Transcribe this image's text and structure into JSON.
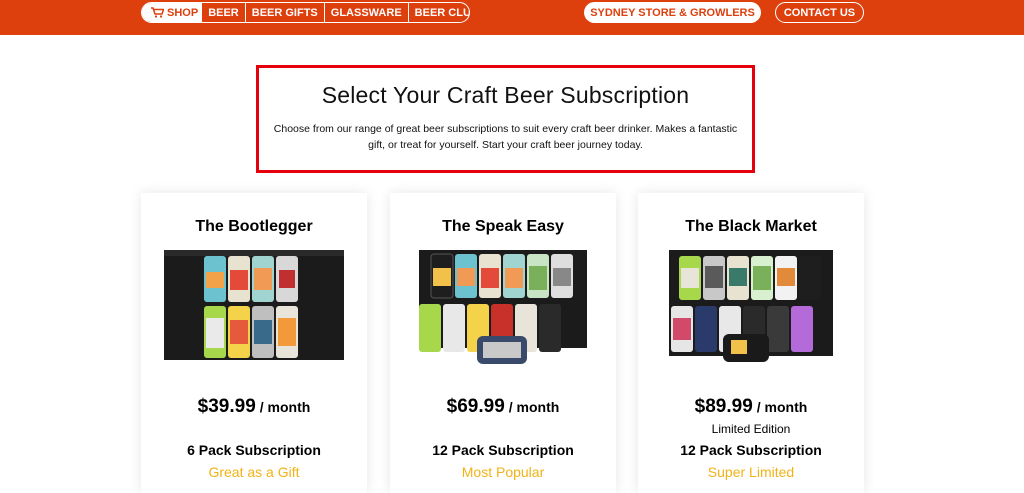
{
  "nav": {
    "shop_label": "SHOP",
    "links": [
      "BEER",
      "BEER GIFTS",
      "GLASSWARE",
      "BEER CLUB"
    ],
    "store_label": "SYDNEY STORE & GROWLERS",
    "contact_label": "CONTACT US"
  },
  "header": {
    "title": "Select Your Craft Beer Subscription",
    "description": "Choose from our range of great beer subscriptions to suit every craft beer drinker. Makes a fantastic gift, or treat for yourself. Start your craft beer journey today."
  },
  "plans": [
    {
      "name": "The Bootlegger",
      "price": "$39.99",
      "per": "/ month",
      "edition": "",
      "pack": "6 Pack Subscription",
      "tagline": "Great as a Gift"
    },
    {
      "name": "The Speak Easy",
      "price": "$69.99",
      "per": "/ month",
      "edition": "",
      "pack": "12 Pack Subscription",
      "tagline": "Most Popular"
    },
    {
      "name": "The Black Market",
      "price": "$89.99",
      "per": "/ month",
      "edition": "Limited Edition",
      "pack": "12 Pack Subscription",
      "tagline": "Super Limited"
    }
  ],
  "colors": {
    "brand": "#dd3f0d",
    "accent": "#f1b215",
    "header_border": "#e6000c"
  },
  "icons": {
    "cart": "shopping-cart-icon"
  }
}
